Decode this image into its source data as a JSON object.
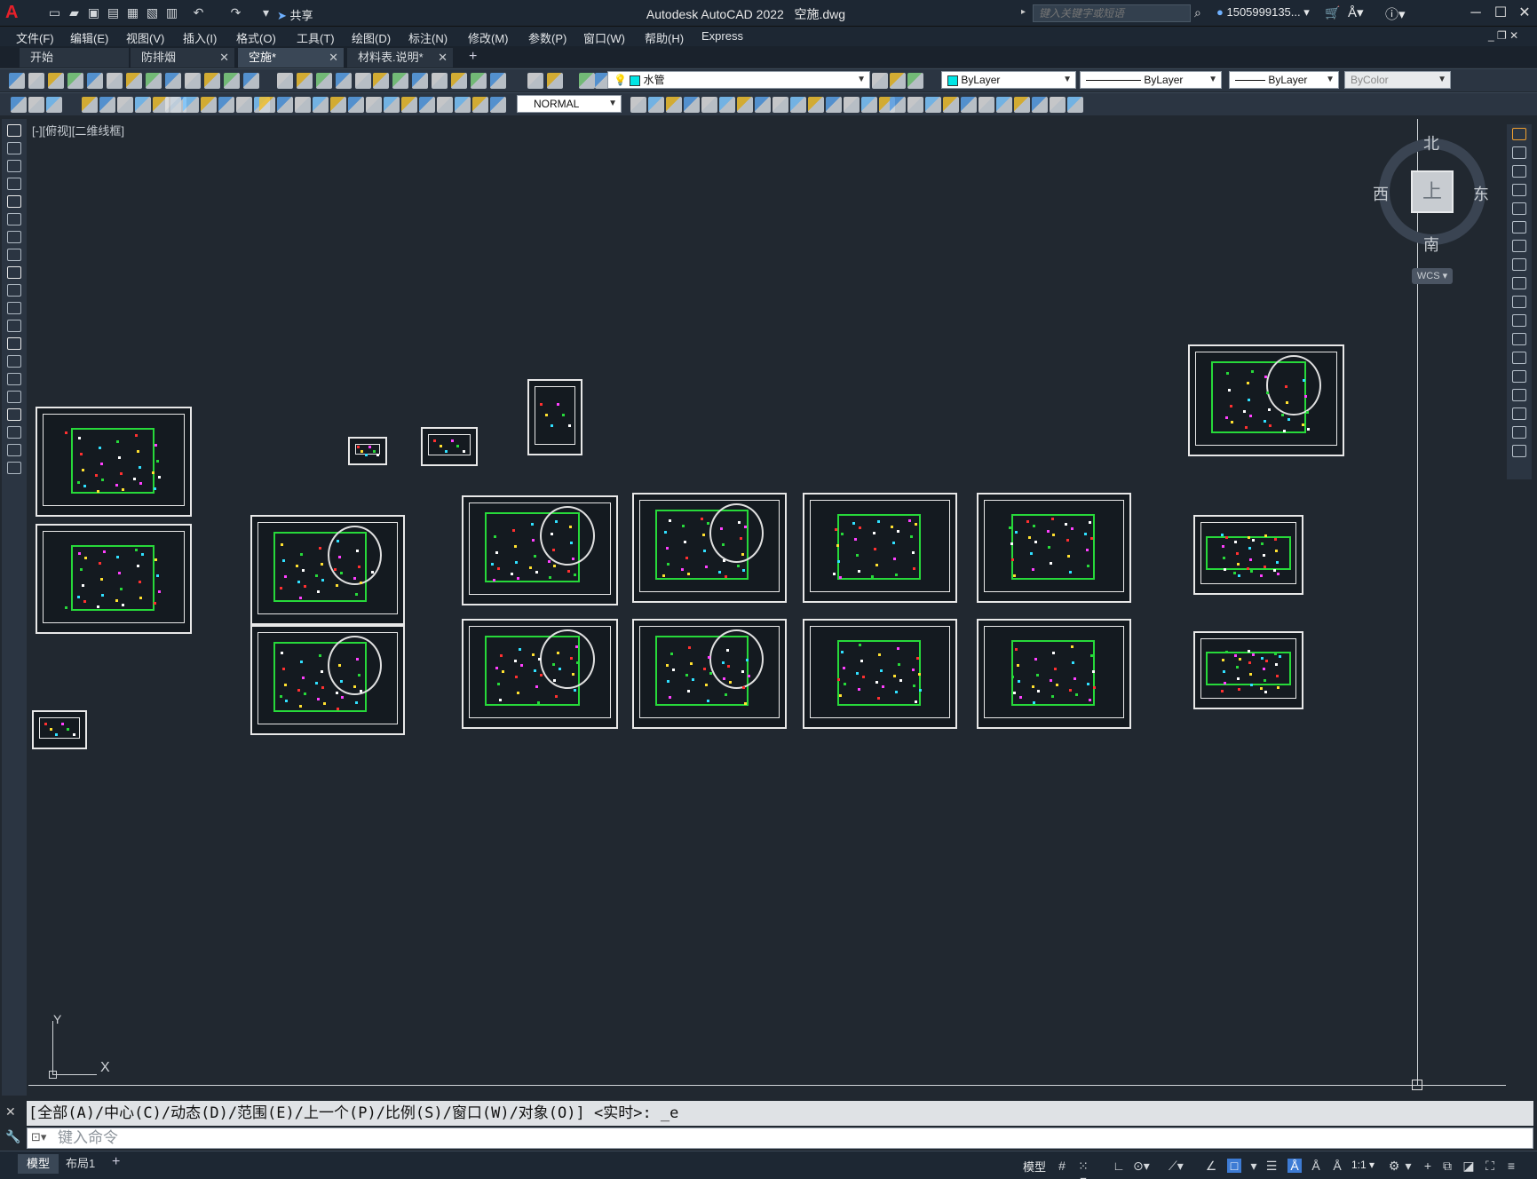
{
  "app": {
    "name": "Autodesk AutoCAD 2022",
    "file": "空施.dwg",
    "logo_letter": "A",
    "share_label": "共享",
    "search_placeholder": "键入关键字或短语",
    "user": "1505999135...",
    "window_controls": [
      "minimize-icon",
      "maximize-icon",
      "close-icon"
    ]
  },
  "menu": [
    "文件(F)",
    "编辑(E)",
    "视图(V)",
    "插入(I)",
    "格式(O)",
    "工具(T)",
    "绘图(D)",
    "标注(N)",
    "修改(M)",
    "参数(P)",
    "窗口(W)",
    "帮助(H)",
    "Express"
  ],
  "tabs": [
    {
      "label": "开始",
      "closable": false,
      "active": false
    },
    {
      "label": "防排烟",
      "closable": true,
      "active": false
    },
    {
      "label": "空施*",
      "closable": true,
      "active": true
    },
    {
      "label": "材料表.说明*",
      "closable": true,
      "active": false
    }
  ],
  "toolbar": {
    "layer_name": "水管",
    "color": "ByLayer",
    "linetype": "ByLayer",
    "lineweight": "ByLayer",
    "plotstyle": "ByColor",
    "dimstyle": "NORMAL",
    "layer_color": "#00e5e5"
  },
  "viewport": {
    "label": "[-][俯视][二维线框]"
  },
  "viewcube": {
    "top": "上",
    "north": "北",
    "south": "南",
    "east": "东",
    "west": "西",
    "wcs": "WCS"
  },
  "ucs": {
    "x": "X",
    "y": "Y"
  },
  "command": {
    "history": "[全部(A)/中心(C)/动态(D)/范围(E)/上一个(P)/比例(S)/窗口(W)/对象(O)] <实时>: _e",
    "placeholder": "键入命令"
  },
  "layout_tabs": [
    {
      "label": "模型",
      "active": true
    },
    {
      "label": "布局1",
      "active": false
    }
  ],
  "status": {
    "mode": "模型",
    "scale": "1:1"
  },
  "colors": {
    "accent": "#3d7bd4",
    "plan_green": "#27d93a",
    "bg": "#212830"
  }
}
